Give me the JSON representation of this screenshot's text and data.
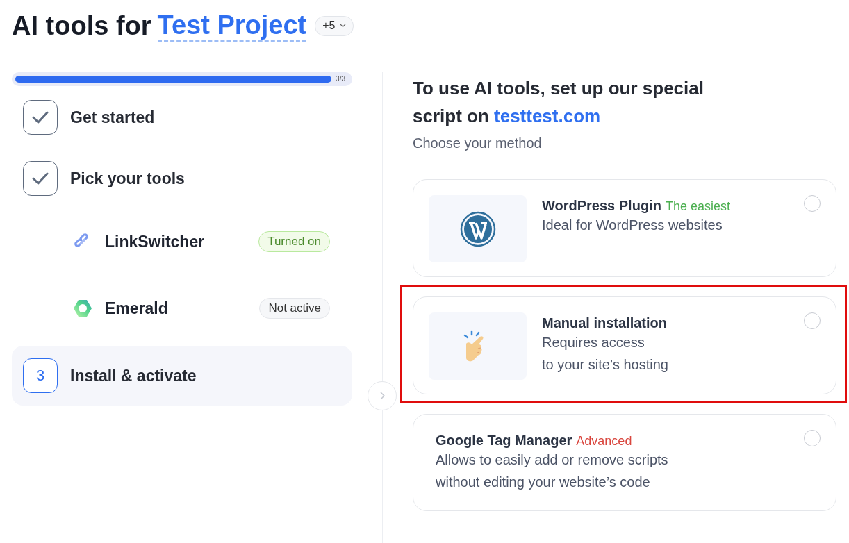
{
  "header": {
    "title": "AI tools for",
    "project": "Test Project",
    "extra_count": "+5"
  },
  "progress": {
    "level": 1,
    "reading": "3/3"
  },
  "steps": [
    {
      "label": "Get started",
      "done": true,
      "selected": false
    },
    {
      "label": "Pick your tools",
      "done": true,
      "selected": false,
      "children": [
        {
          "name": "LinkSwitcher",
          "kind": "link",
          "status": "Turned on",
          "active": true
        },
        {
          "name": "Emerald",
          "kind": "hexagon",
          "status": "Not active",
          "active": false
        }
      ]
    },
    {
      "label": "Install & activate",
      "marker": "3",
      "done": false,
      "selected": true
    }
  ],
  "content": {
    "heading": "To use AI tools, set up our special script on",
    "site": "testtest.com",
    "subheading": "Choose your method",
    "methods": [
      {
        "title": "WordPress Plugin",
        "tag": {
          "text": "The easiest",
          "color": "#4caf50"
        },
        "description": "Ideal for WordPress websites",
        "kind": "wordpress",
        "selected": false,
        "highlighted": false
      },
      {
        "title": "Manual installation",
        "description": "Requires access\nto your site’s hosting",
        "kind": "hand",
        "selected": false,
        "highlighted": true
      },
      {
        "title": "Google Tag Manager",
        "tag": {
          "text": "Advanced",
          "color": "#d9463e"
        },
        "description": "Allows to easily add or remove scripts\nwithout editing your website’s code",
        "kind": "text",
        "selected": false,
        "highlighted": false
      }
    ]
  }
}
